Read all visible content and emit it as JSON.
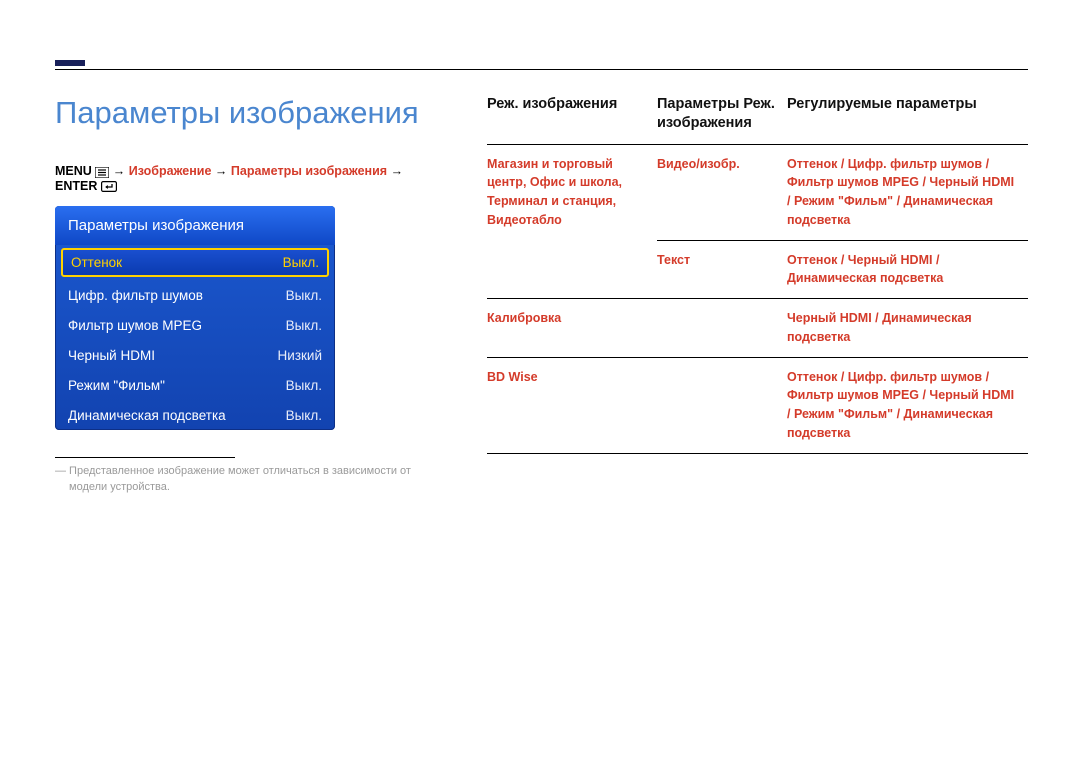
{
  "pageTitle": "Параметры изображения",
  "breadcrumb": {
    "menu": "MENU",
    "arrow": " → ",
    "p1": "Изображение",
    "p2": "Параметры изображения",
    "enter": "ENTER"
  },
  "osd": {
    "header": "Параметры изображения",
    "rows": [
      {
        "label": "Оттенок",
        "value": "Выкл.",
        "selected": true
      },
      {
        "label": "Цифр. фильтр шумов",
        "value": "Выкл.",
        "selected": false
      },
      {
        "label": "Фильтр шумов MPEG",
        "value": "Выкл.",
        "selected": false
      },
      {
        "label": "Черный HDMI",
        "value": "Низкий",
        "selected": false
      },
      {
        "label": "Режим \"Фильм\"",
        "value": "Выкл.",
        "selected": false
      },
      {
        "label": "Динамическая подсветка",
        "value": "Выкл.",
        "selected": false
      }
    ]
  },
  "footnote": "―  Представленное изображение может отличаться в зависимости от модели устройства.",
  "table": {
    "headers": {
      "h1": "Реж. изображения",
      "h2": "Параметры Реж. изображения",
      "h3": "Регулируемые параметры"
    },
    "rows": [
      {
        "c1": "Магазин и торговый центр, Офис и школа, Терминал и станция, Видеотабло",
        "c2": "Видео/изобр.",
        "c3": "Оттенок / Цифр. фильтр шумов / Фильтр шумов MPEG / Черный HDMI / Режим \"Фильм\" / Динамическая подсветка"
      },
      {
        "c1": "",
        "c2": "Текст",
        "c3": "Оттенок / Черный HDMI / Динамическая подсветка"
      },
      {
        "c1": "Калибровка",
        "c2": "",
        "c3": "Черный HDMI / Динамическая подсветка"
      },
      {
        "c1": "BD Wise",
        "c2": "",
        "c3": "Оттенок / Цифр. фильтр шумов / Фильтр шумов MPEG / Черный HDMI / Режим \"Фильм\" / Динамическая подсветка"
      }
    ]
  }
}
